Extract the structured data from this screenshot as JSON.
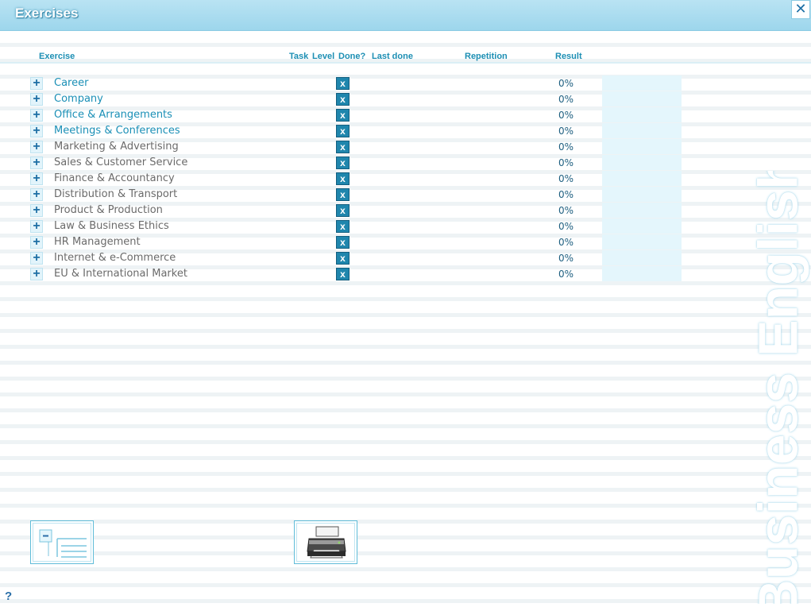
{
  "window": {
    "title": "Exercises",
    "close_label": "✕"
  },
  "columns": {
    "exercise": "Exercise",
    "task": "Task",
    "level": "Level",
    "done": "Done?",
    "last_done": "Last done",
    "repetition": "Repetition",
    "result": "Result"
  },
  "rows": [
    {
      "label": "Career",
      "result": "0%",
      "done": "x",
      "style": "blue"
    },
    {
      "label": "Company",
      "result": "0%",
      "done": "x",
      "style": "blue"
    },
    {
      "label": "Office & Arrangements",
      "result": "0%",
      "done": "x",
      "style": "blue"
    },
    {
      "label": "Meetings & Conferences",
      "result": "0%",
      "done": "x",
      "style": "blue"
    },
    {
      "label": "Marketing & Advertising",
      "result": "0%",
      "done": "x",
      "style": "grey"
    },
    {
      "label": "Sales & Customer Service",
      "result": "0%",
      "done": "x",
      "style": "grey"
    },
    {
      "label": "Finance & Accountancy",
      "result": "0%",
      "done": "x",
      "style": "grey"
    },
    {
      "label": "Distribution & Transport",
      "result": "0%",
      "done": "x",
      "style": "grey"
    },
    {
      "label": "Product & Production",
      "result": "0%",
      "done": "x",
      "style": "grey"
    },
    {
      "label": "Law & Business Ethics",
      "result": "0%",
      "done": "x",
      "style": "grey"
    },
    {
      "label": "HR Management",
      "result": "0%",
      "done": "x",
      "style": "grey"
    },
    {
      "label": "Internet & e-Commerce",
      "result": "0%",
      "done": "x",
      "style": "grey"
    },
    {
      "label": "EU & International Market",
      "result": "0%",
      "done": "x",
      "style": "grey"
    }
  ],
  "expand_symbol": "+",
  "collapse_symbol": "-",
  "help_label": "?",
  "watermark": "Business English",
  "colors": {
    "accent": "#1a8fb6",
    "titlebar": "#9dd6ec",
    "done_box": "#1f86ad"
  },
  "icons": {
    "collapse_tree": "collapse-tree-icon",
    "print": "printer-icon"
  }
}
